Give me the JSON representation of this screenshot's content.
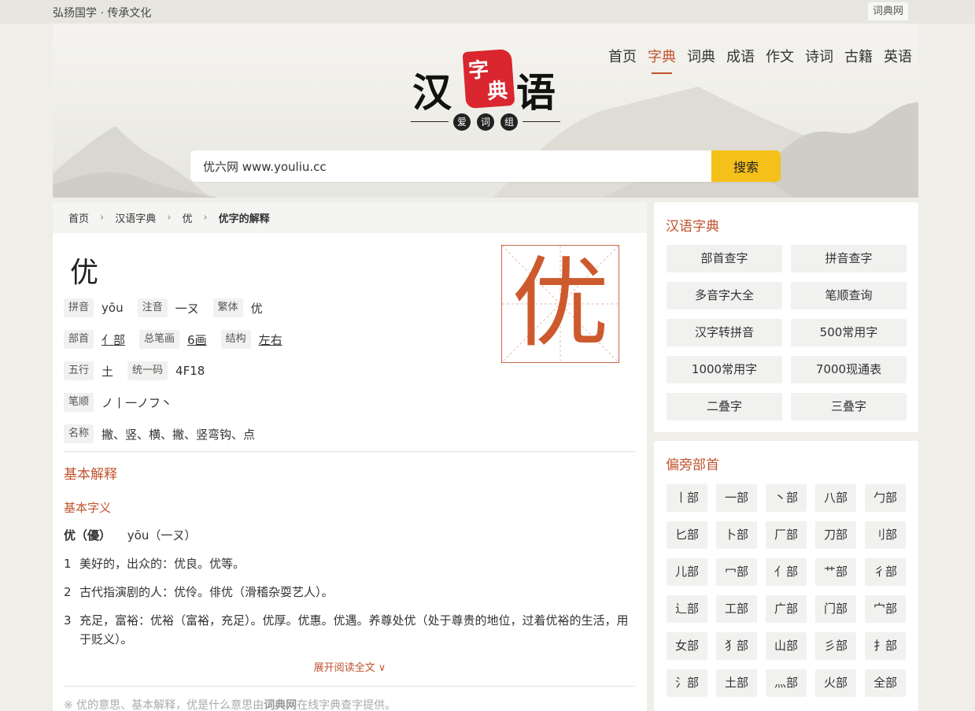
{
  "topbar": {
    "slogan": "弘扬国学 · 传承文化",
    "site_link": "词典网"
  },
  "logo": {
    "left": "汉",
    "right": "语",
    "seal_1": "字",
    "seal_2": "典",
    "dots": [
      "爱",
      "词",
      "组"
    ]
  },
  "nav": {
    "items": [
      "首页",
      "字典",
      "词典",
      "成语",
      "作文",
      "诗词",
      "古籍",
      "英语"
    ],
    "active_index": 1
  },
  "search": {
    "value": "优六网 www.youliu.cc",
    "button": "搜索"
  },
  "breadcrumb": {
    "home": "首页",
    "dict": "汉语字典",
    "char": "优",
    "current": "优字的解释"
  },
  "character": {
    "char": "优",
    "pinyin_label": "拼音",
    "pinyin": "yōu",
    "zhuyin_label": "注音",
    "zhuyin": "一ㄡ",
    "traditional_label": "繁体",
    "traditional": "优",
    "radical_label": "部首",
    "radical": "亻部",
    "strokes_label": "总笔画",
    "strokes": "6画",
    "structure_label": "结构",
    "structure": "左右",
    "wuxing_label": "五行",
    "wuxing": "土",
    "unicode_label": "统一码",
    "unicode": "4F18",
    "order_label": "笔顺",
    "order": "ノ丨一ノフ丶",
    "names_label": "名称",
    "names": "撇、竖、横、撇、竖弯钩、点"
  },
  "basic": {
    "section_title": "基本解释",
    "sub_title": "基本字义",
    "head_char": "优（優）",
    "head_pinyin": "yōu（一ㄡ）",
    "definitions": [
      {
        "n": "1",
        "text": "美好的，出众的：优良。优等。"
      },
      {
        "n": "2",
        "text": "古代指演剧的人：优伶。俳优（滑稽杂耍艺人）。"
      },
      {
        "n": "3",
        "text": "充足，富裕：优裕（富裕，充足）。优厚。优惠。优遇。养尊处优（处于尊贵的地位，过着优裕的生活，用于贬义）。"
      }
    ],
    "more": "展开阅读全文 ∨"
  },
  "note": {
    "prefix": "※ 优的意思、基本解释，优是什么意思由",
    "brand": "词典网",
    "suffix": "在线字典查字提供。"
  },
  "sidebar_dict": {
    "title": "汉语字典",
    "items": [
      "部首查字",
      "拼音查字",
      "多音字大全",
      "笔顺查询",
      "汉字转拼音",
      "500常用字",
      "1000常用字",
      "7000现通表",
      "二叠字",
      "三叠字"
    ]
  },
  "sidebar_radicals": {
    "title": "偏旁部首",
    "items": [
      "丨部",
      "一部",
      "丶部",
      "八部",
      "勹部",
      "匕部",
      "卜部",
      "厂部",
      "刀部",
      "刂部",
      "儿部",
      "冖部",
      "亻部",
      "艹部",
      "彳部",
      "辶部",
      "工部",
      "广部",
      "门部",
      "宀部",
      "女部",
      "犭部",
      "山部",
      "彡部",
      "扌部",
      "氵部",
      "土部",
      "灬部",
      "火部",
      "全部"
    ]
  },
  "colors": {
    "accent": "#c0532f",
    "search_button": "#f6c01a",
    "seal": "#d9262f"
  }
}
